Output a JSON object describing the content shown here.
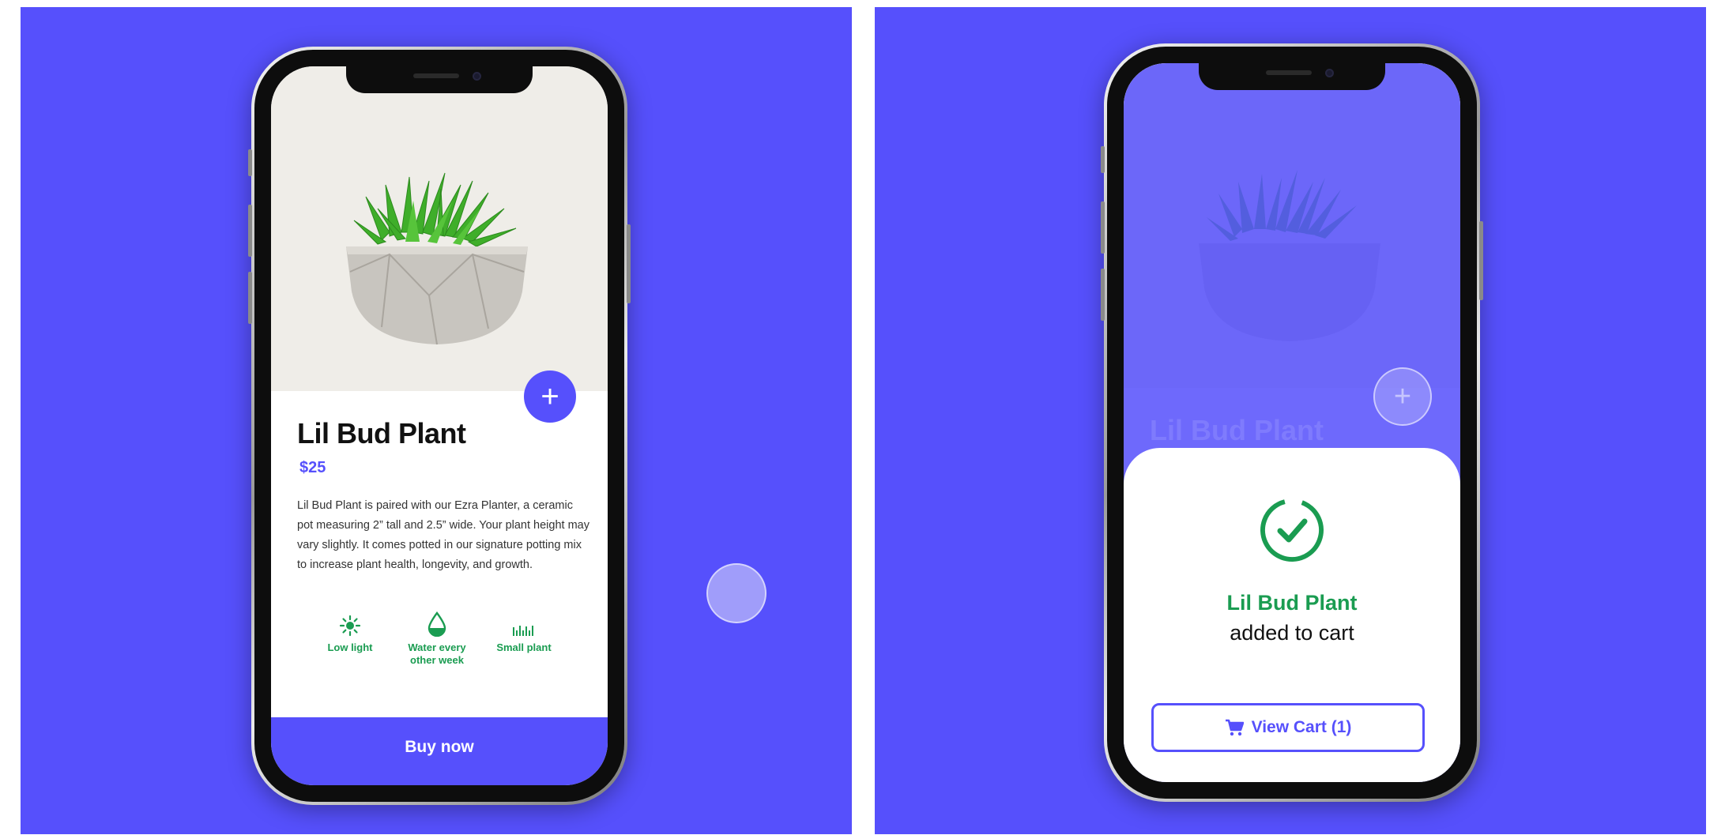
{
  "colors": {
    "background": "#5650fc",
    "accent": "#5650fc",
    "success": "#1a9c51",
    "hero_bg": "#efede8"
  },
  "product_screen": {
    "title": "Lil Bud Plant",
    "price": "$25",
    "description": "Lil Bud Plant is paired with our Ezra Planter, a ceramic pot measuring 2” tall and 2.5” wide. Your plant height may vary slightly. It comes potted in our signature potting mix to increase plant health, longevity, and growth.",
    "add_icon": "plus-icon",
    "add_label": "+",
    "features": [
      {
        "icon": "sun-icon",
        "label": "Low light"
      },
      {
        "icon": "water-drop-icon",
        "label": "Water every other week"
      },
      {
        "icon": "small-plant-icon",
        "label": "Small plant"
      }
    ],
    "buy_label": "Buy now"
  },
  "confirmation_screen": {
    "background_title": "Lil Bud Plant",
    "add_label": "+",
    "check_icon": "check-circle-icon",
    "product_name": "Lil Bud Plant",
    "message": "added to cart",
    "cart_icon": "cart-icon",
    "view_cart_label": "View Cart (1)"
  }
}
